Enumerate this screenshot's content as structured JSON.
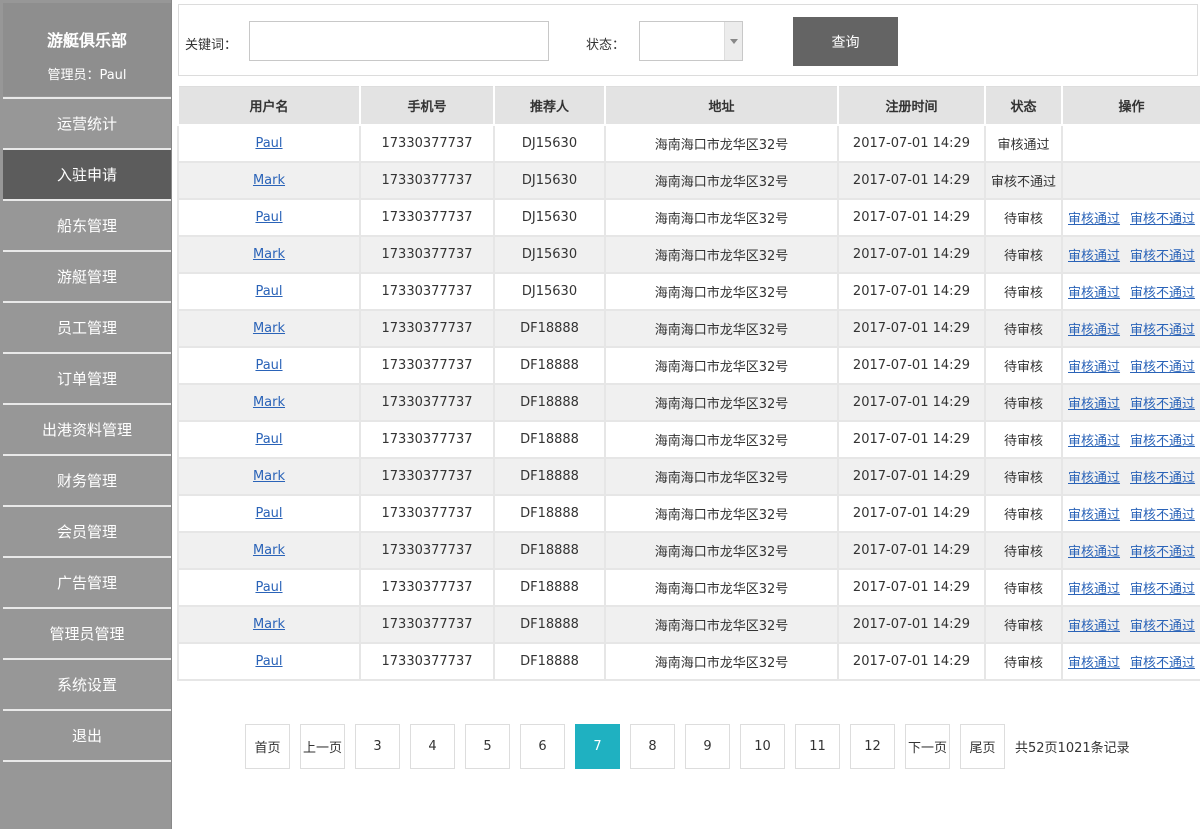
{
  "sidebar": {
    "club_name": "游艇俱乐部",
    "admin_label": "管理员：Paul",
    "items": [
      {
        "label": "运营统计"
      },
      {
        "label": "入驻申请"
      },
      {
        "label": "船东管理"
      },
      {
        "label": "游艇管理"
      },
      {
        "label": "员工管理"
      },
      {
        "label": "订单管理"
      },
      {
        "label": "出港资料管理"
      },
      {
        "label": "财务管理"
      },
      {
        "label": "会员管理"
      },
      {
        "label": "广告管理"
      },
      {
        "label": "管理员管理"
      },
      {
        "label": "系统设置"
      },
      {
        "label": "退出"
      }
    ],
    "active_index": 1
  },
  "search": {
    "keyword_label": "关键词：",
    "keyword_value": "",
    "status_label": "状态：",
    "status_value": "",
    "query_button": "查询"
  },
  "table": {
    "headers": [
      "用户名",
      "手机号",
      "推荐人",
      "地址",
      "注册时间",
      "状态",
      "操作"
    ],
    "approve_label": "审核通过",
    "reject_label": "审核不通过",
    "rows": [
      {
        "user": "Paul",
        "phone": "17330377737",
        "ref": "DJ15630",
        "addr": "海南海口市龙华区32号",
        "time": "2017-07-01 14:29",
        "status": "审核通过",
        "actions": false
      },
      {
        "user": "Mark",
        "phone": "17330377737",
        "ref": "DJ15630",
        "addr": "海南海口市龙华区32号",
        "time": "2017-07-01 14:29",
        "status": "审核不通过",
        "actions": false
      },
      {
        "user": "Paul",
        "phone": "17330377737",
        "ref": "DJ15630",
        "addr": "海南海口市龙华区32号",
        "time": "2017-07-01 14:29",
        "status": "待审核",
        "actions": true
      },
      {
        "user": "Mark",
        "phone": "17330377737",
        "ref": "DJ15630",
        "addr": "海南海口市龙华区32号",
        "time": "2017-07-01 14:29",
        "status": "待审核",
        "actions": true
      },
      {
        "user": "Paul",
        "phone": "17330377737",
        "ref": "DJ15630",
        "addr": "海南海口市龙华区32号",
        "time": "2017-07-01 14:29",
        "status": "待审核",
        "actions": true
      },
      {
        "user": "Mark",
        "phone": "17330377737",
        "ref": "DF18888",
        "addr": "海南海口市龙华区32号",
        "time": "2017-07-01 14:29",
        "status": "待审核",
        "actions": true
      },
      {
        "user": "Paul",
        "phone": "17330377737",
        "ref": "DF18888",
        "addr": "海南海口市龙华区32号",
        "time": "2017-07-01 14:29",
        "status": "待审核",
        "actions": true
      },
      {
        "user": "Mark",
        "phone": "17330377737",
        "ref": "DF18888",
        "addr": "海南海口市龙华区32号",
        "time": "2017-07-01 14:29",
        "status": "待审核",
        "actions": true
      },
      {
        "user": "Paul",
        "phone": "17330377737",
        "ref": "DF18888",
        "addr": "海南海口市龙华区32号",
        "time": "2017-07-01 14:29",
        "status": "待审核",
        "actions": true
      },
      {
        "user": "Mark",
        "phone": "17330377737",
        "ref": "DF18888",
        "addr": "海南海口市龙华区32号",
        "time": "2017-07-01 14:29",
        "status": "待审核",
        "actions": true
      },
      {
        "user": "Paul",
        "phone": "17330377737",
        "ref": "DF18888",
        "addr": "海南海口市龙华区32号",
        "time": "2017-07-01 14:29",
        "status": "待审核",
        "actions": true
      },
      {
        "user": "Mark",
        "phone": "17330377737",
        "ref": "DF18888",
        "addr": "海南海口市龙华区32号",
        "time": "2017-07-01 14:29",
        "status": "待审核",
        "actions": true
      },
      {
        "user": "Paul",
        "phone": "17330377737",
        "ref": "DF18888",
        "addr": "海南海口市龙华区32号",
        "time": "2017-07-01 14:29",
        "status": "待审核",
        "actions": true
      },
      {
        "user": "Mark",
        "phone": "17330377737",
        "ref": "DF18888",
        "addr": "海南海口市龙华区32号",
        "time": "2017-07-01 14:29",
        "status": "待审核",
        "actions": true
      },
      {
        "user": "Paul",
        "phone": "17330377737",
        "ref": "DF18888",
        "addr": "海南海口市龙华区32号",
        "time": "2017-07-01 14:29",
        "status": "待审核",
        "actions": true
      }
    ]
  },
  "pagination": {
    "first": "首页",
    "prev": "上一页",
    "pages": [
      "3",
      "4",
      "5",
      "6",
      "7",
      "8",
      "9",
      "10",
      "11",
      "12"
    ],
    "current": "7",
    "next": "下一页",
    "last": "尾页",
    "summary": "共52页1021条记录"
  },
  "colors": {
    "sidebar_bg": "#979797",
    "sidebar_active": "#5c5c5c",
    "query_button": "#646464",
    "current_page": "#1fb1c1",
    "link": "#2a63b8"
  }
}
